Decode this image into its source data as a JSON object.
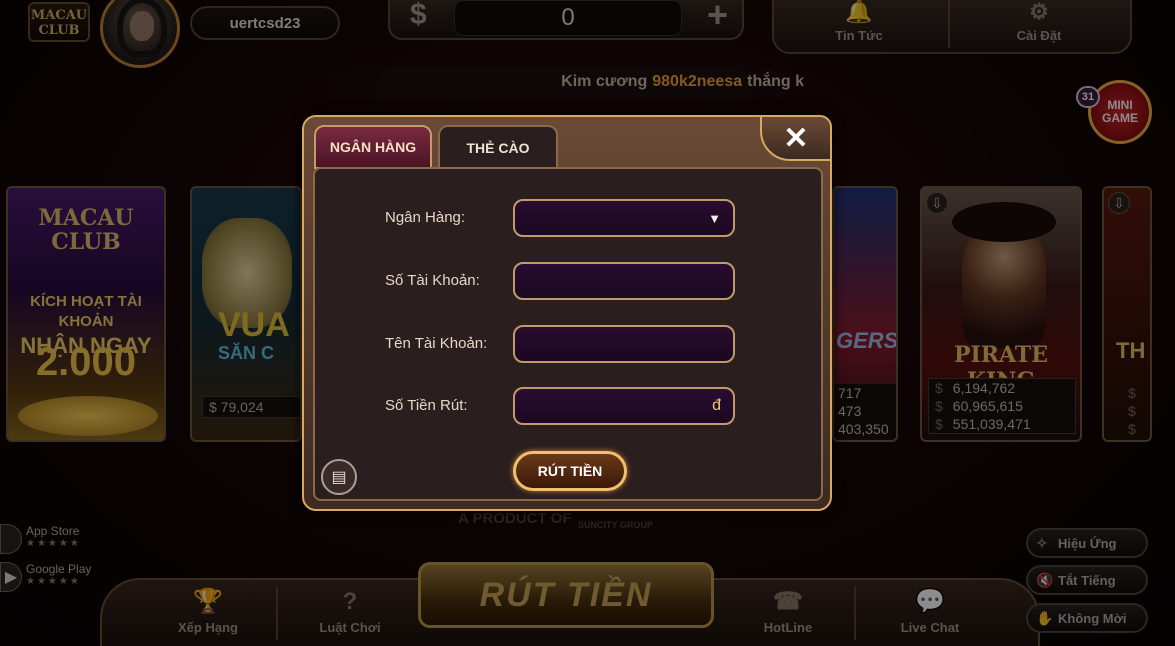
{
  "header": {
    "logo": "MACAU CLUB",
    "username": "uertcsd23",
    "currency_symbol": "$",
    "balance": "0",
    "add_symbol": "+",
    "news_label": "Tin Tức",
    "settings_label": "Cài Đặt"
  },
  "ticker": {
    "prefix": "Kim cương",
    "highlight": "980k2neesa",
    "suffix": "thắng k"
  },
  "minigame": {
    "label": "MINI GAME",
    "badge": "31"
  },
  "cards": {
    "promo": {
      "logo": "MACAU CLUB",
      "line1": "KÍCH HOẠT TÀI KHOẢN",
      "line2": "NHẬN NGAY",
      "amount": "2.000"
    },
    "vua": {
      "title": "VUA",
      "subtitle": "SĂN C",
      "jackpot": "$  79,024"
    },
    "avengers": {
      "title": "GERS",
      "j1": "717",
      "j2": "473",
      "j3": "403,350"
    },
    "pirate": {
      "title": "PIRATE KING",
      "cur": "$",
      "j1": "6,194,762",
      "j2": "60,965,615",
      "j3": "551,039,471"
    },
    "last": {
      "title": "TH",
      "cur": "$"
    }
  },
  "bottom": {
    "product": "A PRODUCT OF",
    "group": "SUNCITY GROUP",
    "app_store": "App Store",
    "google_play": "Google Play",
    "stars": "★★★★★",
    "ranking": "Xếp Hạng",
    "rules": "Luật Chơi",
    "withdraw_big": "RÚT TIỀN",
    "hotline": "HotLine",
    "live_chat": "Live Chat",
    "effects": "Hiệu Ứng",
    "mute": "Tắt Tiếng",
    "invite": "Không Mời"
  },
  "modal": {
    "tab_bank": "NGÂN HÀNG",
    "tab_card": "THẺ CÀO",
    "close": "✕",
    "bank_label": "Ngân Hàng:",
    "account_number_label": "Số Tài Khoản:",
    "account_name_label": "Tên Tài Khoản:",
    "amount_label": "Số Tiền Rút:",
    "currency_suffix": "đ",
    "submit": "RÚT TIỀN"
  }
}
